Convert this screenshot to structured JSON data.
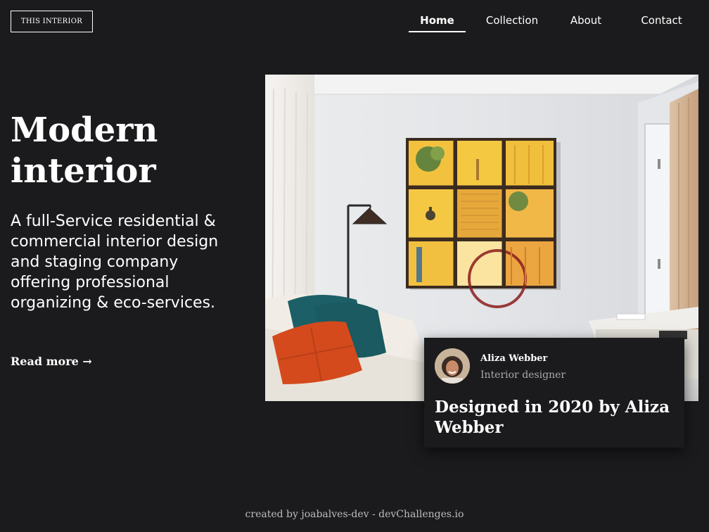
{
  "header": {
    "logo": "THIS INTERIOR",
    "nav": [
      "Home",
      "Collection",
      "About",
      "Contact"
    ],
    "active_nav": "Home"
  },
  "hero": {
    "title_line1": "Modern",
    "title_line2": "interior",
    "description": "A full-Service residential & commercial interior design and staging company offering professional organizing & eco-services.",
    "read_more": "Read more →"
  },
  "card": {
    "author_name": "Aliza Webber",
    "author_role": "Interior designer",
    "title": "Designed in 2020 by Aliza Webber"
  },
  "footer": "created by joabalves-dev - devChallenges.io",
  "colors": {
    "background": "#1b1b1d",
    "text": "#ffffff",
    "muted": "#a9a9ab"
  }
}
